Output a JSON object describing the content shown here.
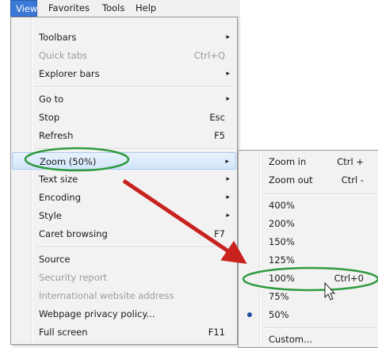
{
  "menubar": {
    "items": [
      "View",
      "Favorites",
      "Tools",
      "Help"
    ]
  },
  "view_menu": {
    "items": [
      {
        "label": "Toolbars",
        "shortcut": "",
        "submenu": true,
        "disabled": false
      },
      {
        "label": "Quick tabs",
        "shortcut": "Ctrl+Q",
        "submenu": false,
        "disabled": true
      },
      {
        "label": "Explorer bars",
        "shortcut": "",
        "submenu": true,
        "disabled": false
      },
      {
        "label": "Go to",
        "shortcut": "",
        "submenu": true,
        "disabled": false
      },
      {
        "label": "Stop",
        "shortcut": "Esc",
        "submenu": false,
        "disabled": false
      },
      {
        "label": "Refresh",
        "shortcut": "F5",
        "submenu": false,
        "disabled": false
      },
      {
        "label": "Zoom (50%)",
        "shortcut": "",
        "submenu": true,
        "disabled": false,
        "highlighted": true
      },
      {
        "label": "Text size",
        "shortcut": "",
        "submenu": true,
        "disabled": false
      },
      {
        "label": "Encoding",
        "shortcut": "",
        "submenu": true,
        "disabled": false
      },
      {
        "label": "Style",
        "shortcut": "",
        "submenu": true,
        "disabled": false
      },
      {
        "label": "Caret browsing",
        "shortcut": "F7",
        "submenu": false,
        "disabled": false
      },
      {
        "label": "Source",
        "shortcut": "",
        "submenu": false,
        "disabled": false
      },
      {
        "label": "Security report",
        "shortcut": "",
        "submenu": false,
        "disabled": true
      },
      {
        "label": "International website address",
        "shortcut": "",
        "submenu": false,
        "disabled": true
      },
      {
        "label": "Webpage privacy policy...",
        "shortcut": "",
        "submenu": false,
        "disabled": false
      },
      {
        "label": "Full screen",
        "shortcut": "F11",
        "submenu": false,
        "disabled": false
      }
    ],
    "submenu_arrow": "▸"
  },
  "zoom_submenu": {
    "items": [
      {
        "label": "Zoom in",
        "shortcut": "Ctrl +"
      },
      {
        "label": "Zoom out",
        "shortcut": "Ctrl -"
      },
      {
        "label": "400%",
        "shortcut": ""
      },
      {
        "label": "200%",
        "shortcut": ""
      },
      {
        "label": "150%",
        "shortcut": ""
      },
      {
        "label": "125%",
        "shortcut": ""
      },
      {
        "label": "100%",
        "shortcut": "Ctrl+0"
      },
      {
        "label": "75%",
        "shortcut": ""
      },
      {
        "label": "50%",
        "shortcut": "",
        "selected": true
      },
      {
        "label": "Custom...",
        "shortcut": ""
      }
    ]
  },
  "colors": {
    "annotation_ellipse": "#2e9a3e",
    "annotation_arrow": "#c8221f",
    "menu_highlight": "#3c78d6"
  }
}
